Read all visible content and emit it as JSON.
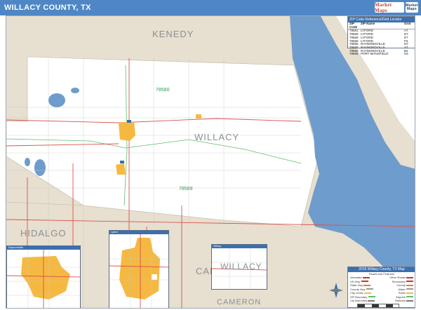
{
  "title": "WILLACY COUNTY, TX",
  "logo": {
    "brand": "Market Maps",
    "sub": "Market Maps"
  },
  "counties": {
    "kenedy": "KENEDY",
    "willacy": "WILLACY",
    "hidalgo": "HIDALGO",
    "cameron_partial": "CAM",
    "cameron": "CAMERON"
  },
  "zip_labels": [
    "78580",
    "78569"
  ],
  "zip_table": {
    "header": "ZIP Code Reference/Grid Locator",
    "columns": [
      "ZIP Code",
      "ZIP Name",
      "Grid"
    ],
    "rows": [
      [
        "78561",
        "LYFORD",
        "A7"
      ],
      [
        "78569",
        "LYFORD",
        "D7"
      ],
      [
        "78569",
        "LYFORD",
        "E7"
      ],
      [
        "78569",
        "LYFORD",
        "F5"
      ],
      [
        "78580",
        "RAYMONDVILLE",
        "D7"
      ],
      [
        "78580",
        "RAYMONDVILLE",
        "A7"
      ],
      [
        "78580",
        "RAYMONDVILLE",
        "B2"
      ],
      [
        "78598",
        "PORT MANSFIELD",
        "H2"
      ]
    ]
  },
  "insets": [
    {
      "title": "Raymondville"
    },
    {
      "title": "Lyford"
    },
    {
      "title": "Willacy",
      "label": "WILLACY"
    }
  ],
  "legend": {
    "title": "2016 Willacy County, TX Map",
    "subtitle": "Roads and Features",
    "rows": [
      [
        "Interstate",
        "Other Roads"
      ],
      [
        "US Hwy",
        "Secondary"
      ],
      [
        "State Hwy",
        "County"
      ],
      [
        "County Hwy",
        "Water"
      ],
      [
        "City Limits",
        "Parks"
      ],
      [
        "ZIP Boundary",
        "Airports"
      ],
      [
        "Cty Boundary",
        "Railroad"
      ]
    ],
    "colors": {
      "interstate": "#c0392b",
      "us_hwy": "#c0392b",
      "state_hwy": "#e07a3a",
      "city": "#f5b942",
      "zip": "#5bbf6a",
      "water": "#a9c8e8"
    }
  },
  "colors": {
    "title_bg": "#4f86c6",
    "land_outside": "#e7dfcf",
    "county_fill": "#ffffff",
    "water": "#6e9ccc",
    "water_light": "#a9c8e8",
    "city": "#f5b942",
    "highway": "#d9534f",
    "zip_line": "#5bbf6a"
  }
}
